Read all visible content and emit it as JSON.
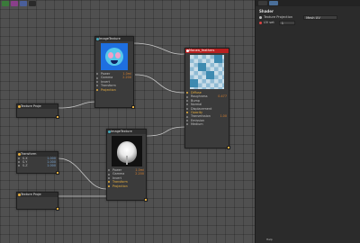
{
  "toolbar": {
    "buttons": [
      {
        "name": "tool-select",
        "color": "#3a7a3a"
      },
      {
        "name": "tool-pan",
        "color": "#8a3f8a"
      },
      {
        "name": "tool-zoom",
        "color": "#4a5f9a"
      },
      {
        "name": "tool-close",
        "color": "#2a2a2a"
      }
    ]
  },
  "panel": {
    "tabs": [
      "",
      ""
    ],
    "title": "Shader",
    "texture_projection_label": "Texture Projection",
    "texture_projection_value": "Mesh UV",
    "uv_set_label": "UV set",
    "uv_set_value": "1",
    "footer": "Help"
  },
  "nodes": {
    "image1": {
      "title": "ImageTexture",
      "inputs": [
        {
          "label": "Power",
          "value": "1.0mi"
        },
        {
          "label": "Gamma",
          "value": "2.200"
        },
        {
          "label": "Invert",
          "value": ""
        },
        {
          "label": "Transform",
          "value": ""
        },
        {
          "label": "Projection",
          "value": ""
        }
      ]
    },
    "material": {
      "title": "Macaw_feathers",
      "inputs": [
        {
          "label": "Diffuse",
          "value": ""
        },
        {
          "label": "Roughness",
          "value": "0.477"
        },
        {
          "label": "Bump",
          "value": ""
        },
        {
          "label": "Normal",
          "value": ""
        },
        {
          "label": "Displacement",
          "value": ""
        },
        {
          "label": "Opacity",
          "value": ""
        },
        {
          "label": "Transmission",
          "value": "1.00"
        },
        {
          "label": "Emission",
          "value": ""
        },
        {
          "label": "Medium",
          "value": ""
        }
      ]
    },
    "image2": {
      "title": "ImageTexture",
      "inputs": [
        {
          "label": "Power",
          "value": "1.0mi"
        },
        {
          "label": "Gamma",
          "value": "2.200"
        },
        {
          "label": "Invert",
          "value": ""
        },
        {
          "label": "Transform",
          "value": ""
        },
        {
          "label": "Projection",
          "value": ""
        }
      ]
    },
    "proj1": {
      "title": "Texture Proje"
    },
    "transform": {
      "title": "Transform",
      "inputs": [
        {
          "label": "S.X",
          "value": "1.000"
        },
        {
          "label": "S.Y",
          "value": "1.000"
        },
        {
          "label": "S.Z",
          "value": "1.000"
        }
      ]
    },
    "proj2": {
      "title": "Texture Proje"
    }
  }
}
